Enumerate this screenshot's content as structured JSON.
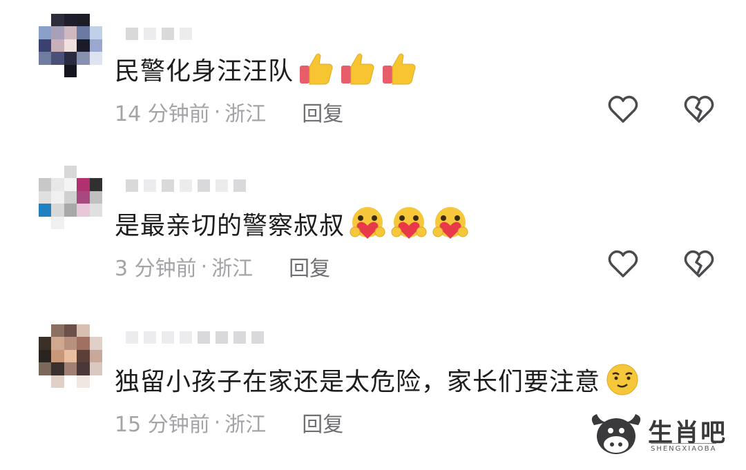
{
  "comments": [
    {
      "text": "民警化身汪汪队",
      "time": "14 分钟前",
      "location": "浙江",
      "emoji": "thumbs-up-icon",
      "emoji_count": 3
    },
    {
      "text": "是最亲切的警察叔叔",
      "time": "3 分钟前",
      "location": "浙江",
      "emoji": "hug-heart-emoji-icon",
      "emoji_count": 3
    },
    {
      "text": "独留小孩子在家还是太危险，家长们要注意",
      "time": "15 分钟前",
      "location": "浙江",
      "emoji": "smirk-emoji-icon",
      "emoji_count": 1
    }
  ],
  "reply_label": "回复",
  "separator": "·",
  "watermark": {
    "name": "生肖吧",
    "sub": "SHENGXIAOBA"
  },
  "colors": {
    "text": "#1d1d1f",
    "meta": "#a3a3a8",
    "reply": "#6e6e73",
    "icon": "#4a4a4f"
  }
}
